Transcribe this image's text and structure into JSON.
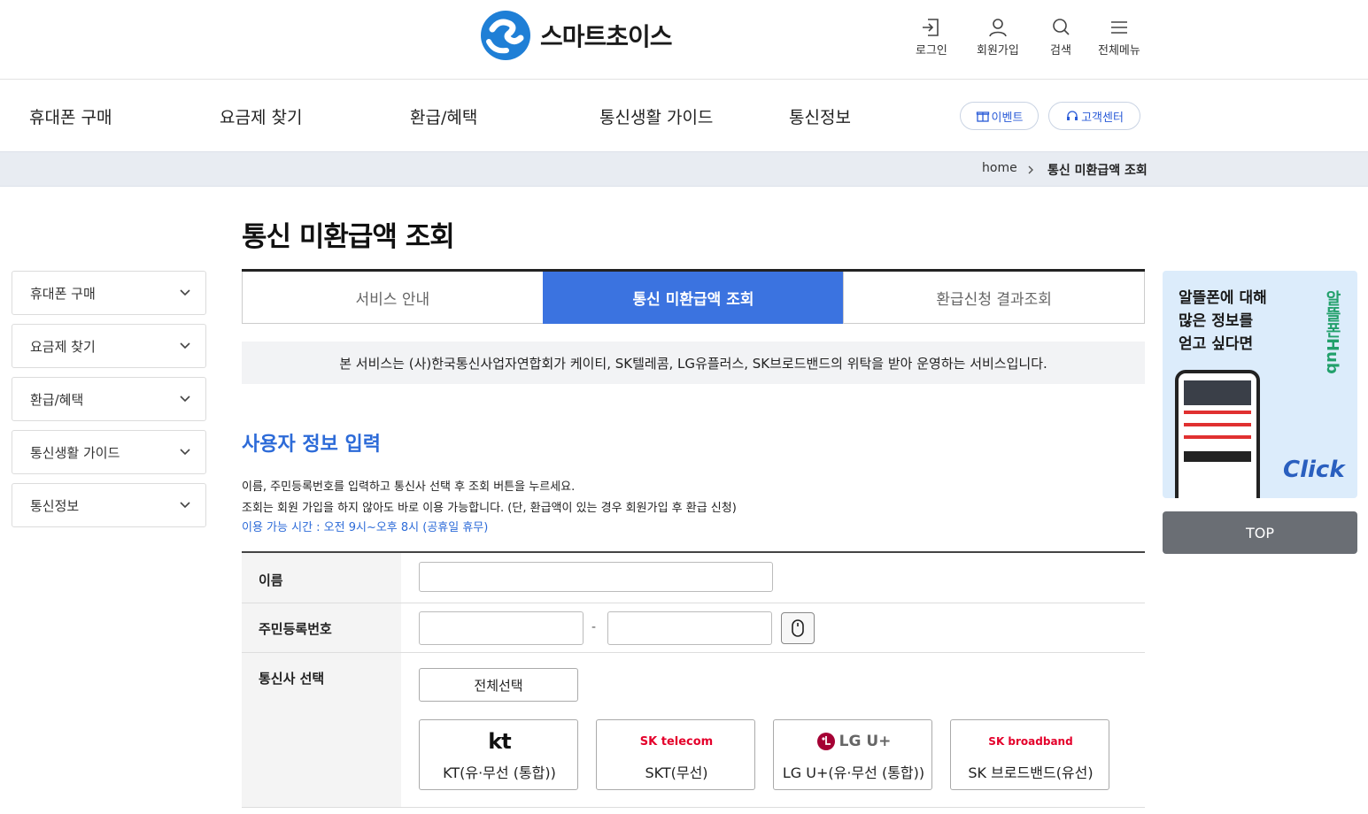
{
  "header": {
    "logo_text": "스마트초이스",
    "util": [
      {
        "label": "로그인",
        "icon": "login-icon"
      },
      {
        "label": "회원가입",
        "icon": "user-icon"
      },
      {
        "label": "검색",
        "icon": "search-icon"
      },
      {
        "label": "전체메뉴",
        "icon": "menu-icon"
      }
    ]
  },
  "gnb": {
    "items": [
      "휴대폰 구매",
      "요금제 찾기",
      "환급/혜택",
      "통신생활 가이드",
      "통신정보"
    ],
    "event_label": "이벤트",
    "support_label": "고객센터"
  },
  "breadcrumb": {
    "home": "home",
    "current": "통신 미환급액 조회"
  },
  "page_title": "통신 미환급액 조회",
  "left_nav": [
    "휴대폰 구매",
    "요금제 찾기",
    "환급/혜택",
    "통신생활 가이드",
    "통신정보"
  ],
  "tabs": [
    "서비스 안내",
    "통신 미환급액 조회",
    "환급신청 결과조회"
  ],
  "notice": "본 서비스는 (사)한국통신사업자연합회가 케이티, SK텔레콤, LG유플러스, SK브로드밴드의 위탁을 받아 운영하는 서비스입니다.",
  "section": {
    "title": "사용자 정보 입력",
    "desc1": "이름, 주민등록번호를 입력하고 통신사 선택 후 조회 버튼을 누르세요.",
    "desc2": "조회는 회원 가입을 하지 않아도 바로 이용 가능합니다. (단, 환급액이 있는 경우 회원가입 후 환급 신청)",
    "hours": "이용 가능 시간 : 오전 9시~오후 8시 (공휴일 휴무)"
  },
  "form": {
    "name_label": "이름",
    "rrn_label": "주민등록번호",
    "rrn_sep": "-",
    "carrier_label": "통신사 선택",
    "select_all": "전체선택",
    "carriers": [
      {
        "logo": "kt",
        "name": "KT(유·무선 (통합))"
      },
      {
        "logo": "SK telecom",
        "name": "SKT(무선)"
      },
      {
        "logo": "LG U+",
        "name": "LG U+(유·무선 (통합))"
      },
      {
        "logo": "SK broadband",
        "name": "SK 브로드밴드(유선)"
      }
    ]
  },
  "banner": {
    "text": "알뜰폰에 대해\n많은 정보를\n얻고 싶다면",
    "brand": "알뜰폰Hub",
    "click": "Click"
  },
  "top_button": "TOP",
  "colors": {
    "accent": "#3b73e0",
    "section_title": "#2d6bd8",
    "banner_bg": "#dcecfb"
  }
}
